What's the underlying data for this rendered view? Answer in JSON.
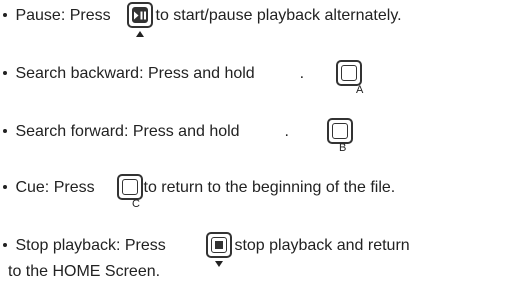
{
  "items": [
    {
      "before": "Pause: Press",
      "after": "to start/pause playback alternately.",
      "button_icon": "play-pause-icon"
    },
    {
      "before": "Search backward: Press and hold",
      "after": ".",
      "button_label": "A"
    },
    {
      "before": "Search forward: Press and hold",
      "after": ".",
      "button_label": "B"
    },
    {
      "before": "Cue: Press",
      "after": "to return to the beginning of the file.",
      "button_label": "C"
    },
    {
      "before": "Stop playback: Press",
      "after": "to stop playback and return",
      "continuation": "to the HOME Screen.",
      "button_icon": "stop-icon"
    }
  ],
  "colors": {
    "text": "#222222",
    "button_border": "#333333"
  }
}
